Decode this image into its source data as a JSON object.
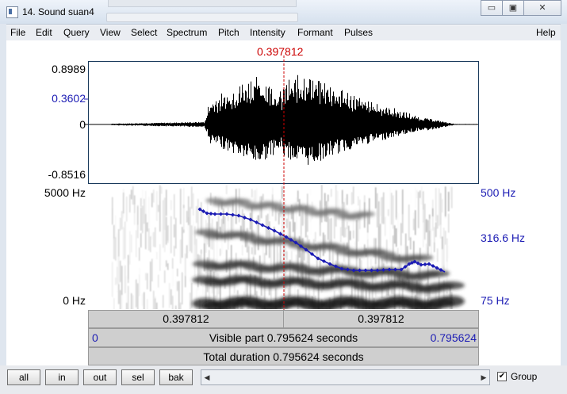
{
  "window": {
    "title": "14. Sound suan4",
    "minimize_glyph": "▭",
    "maximize_glyph": "▣",
    "close_glyph": "✕"
  },
  "menu": [
    "File",
    "Edit",
    "Query",
    "View",
    "Select",
    "Spectrum",
    "Pitch",
    "Intensity",
    "Formant",
    "Pulses"
  ],
  "help": "Help",
  "cursor_time": "0.397812",
  "waveform": {
    "y_max": "0.8989",
    "y_cursor": "0.3602",
    "y_zero": "0",
    "y_min": "-0.8516"
  },
  "spectrogram": {
    "freq_max": "5000 Hz",
    "freq_min": "0 Hz",
    "pitch_max": "500 Hz",
    "pitch_cursor": "316.6 Hz",
    "pitch_min": "75 Hz"
  },
  "selection": {
    "left": "0.397812",
    "right": "0.397812"
  },
  "visible": {
    "start": "0",
    "label": "Visible part 0.795624 seconds",
    "end": "0.795624"
  },
  "total_duration": "Total duration 0.795624 seconds",
  "buttons": [
    "all",
    "in",
    "out",
    "sel",
    "bak"
  ],
  "group": {
    "label": "Group",
    "checked": true
  },
  "colors": {
    "cursor": "#cc0000",
    "pitch": "#1c1cb4",
    "wave_border": "#1a3a5c"
  }
}
